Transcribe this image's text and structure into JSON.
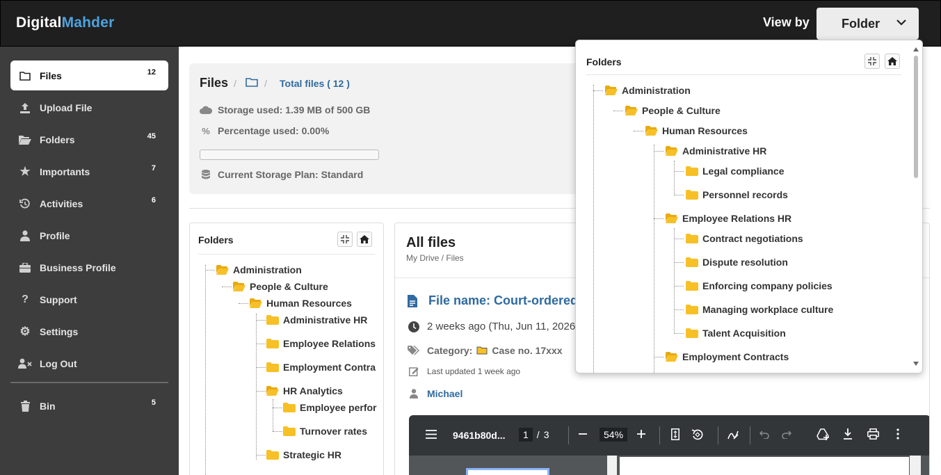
{
  "app": {
    "brand_part1": "Digital",
    "brand_part2": "Mahder"
  },
  "topbar": {
    "viewby_label": "View by",
    "viewby_value": "Folder"
  },
  "sidebar": {
    "items": [
      {
        "label": "Files",
        "count": "12",
        "icon": "folder-outline-icon",
        "active": true
      },
      {
        "label": "Upload File",
        "count": "",
        "icon": "upload-icon"
      },
      {
        "label": "Folders",
        "count": "45",
        "icon": "folder-open-icon"
      },
      {
        "label": "Importants",
        "count": "7",
        "icon": "star-icon"
      },
      {
        "label": "Activities",
        "count": "6",
        "icon": "history-icon"
      },
      {
        "label": "Profile",
        "count": "",
        "icon": "user-icon"
      },
      {
        "label": "Business Profile",
        "count": "",
        "icon": "briefcase-icon"
      },
      {
        "label": "Support",
        "count": "",
        "icon": "question-icon"
      },
      {
        "label": "Settings",
        "count": "",
        "icon": "gear-icon"
      },
      {
        "label": "Log Out",
        "count": "",
        "icon": "user-x-icon"
      }
    ],
    "bin": {
      "label": "Bin",
      "count": "5",
      "icon": "trash-icon"
    }
  },
  "info": {
    "title": "Files",
    "total_files": "Total files  ( 12 )",
    "storage_used": "Storage used: 1.39 MB of 500 GB",
    "percentage_used": "Percentage used: 0.00%",
    "storage_progress": 0.0,
    "storage_plan": "Current Storage Plan: Standard"
  },
  "folders_panel": {
    "title": "Folders",
    "tree": [
      "Administration",
      "People & Culture",
      "Human Resources",
      "Administrative HR",
      "Employee Relations",
      "Employment Contra",
      "HR Analytics",
      "Employee perfor",
      "Turnover rates",
      "Strategic HR"
    ]
  },
  "files_panel": {
    "title": "All files",
    "breadcrumb": "My Drive / Files",
    "file_name": "File name: Court-ordered",
    "date": "2 weeks ago (Thu, Jun 11, 2026",
    "category_label": "Category:",
    "category_value": "Case no. 17xxx",
    "last_updated": "Last updated 1 week ago",
    "owner": "Michael"
  },
  "pdf_viewer": {
    "doc_name": "9461b80d...",
    "page_current": "1",
    "page_sep": "/",
    "page_total": "3",
    "zoom": "54%"
  },
  "popup": {
    "title": "Folders",
    "tree": [
      "Administration",
      "People & Culture",
      "Human Resources",
      "Administrative HR",
      "Legal compliance",
      "Personnel records",
      "Employee Relations HR",
      "Contract negotiations",
      "Dispute resolution",
      "Enforcing company policies",
      "Managing workplace culture",
      "Talent Acquisition",
      "Employment Contracts"
    ]
  },
  "colors": {
    "accent": "#2f6aa0",
    "brand_blue": "#4da3e0",
    "folder": "#f6c026",
    "sidebar_bg": "#3d3d3d",
    "topbar_bg": "#1f1f1f"
  }
}
